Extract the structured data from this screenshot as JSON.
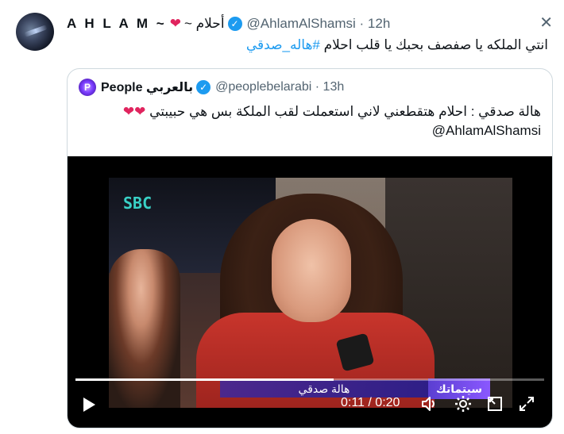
{
  "tweet": {
    "display_name": "A H L A M ~",
    "display_name_suffix": "~ أحلام",
    "handle": "@AhlamAlShamsi",
    "time": "12h",
    "text_prefix": "انتي الملكه يا صفصف بحبك يا قلب احلام ",
    "hashtag": "#هاله_صدقي"
  },
  "quoted": {
    "display_name": "People بالعربي",
    "handle": "@peoplebelarabi",
    "time": "13h",
    "text_line1": "هالة صدقي : احلام هتقطعني لاني استعملت لقب الملكة بس هي حبيبتي",
    "text_line2": "@AhlamAlShamsi",
    "hearts": "❤❤"
  },
  "video": {
    "overlay_name": "هالة صدقي",
    "overlay_logo": "سيتماتك",
    "sbc_logo": "SBC",
    "current_time": "0:11",
    "duration": "0:20",
    "time_display": "0:11 / 0:20",
    "progress": 0.55
  },
  "icons": {
    "play": "play-icon",
    "volume": "volume-icon",
    "settings": "gear-icon",
    "pip": "picture-in-picture-icon",
    "fullscreen": "fullscreen-icon",
    "close": "close-icon",
    "verified": "verified-badge-icon"
  },
  "colors": {
    "verified": "#1d9bf0",
    "hashtag": "#1d9bf0",
    "heart": "#e0245e"
  }
}
